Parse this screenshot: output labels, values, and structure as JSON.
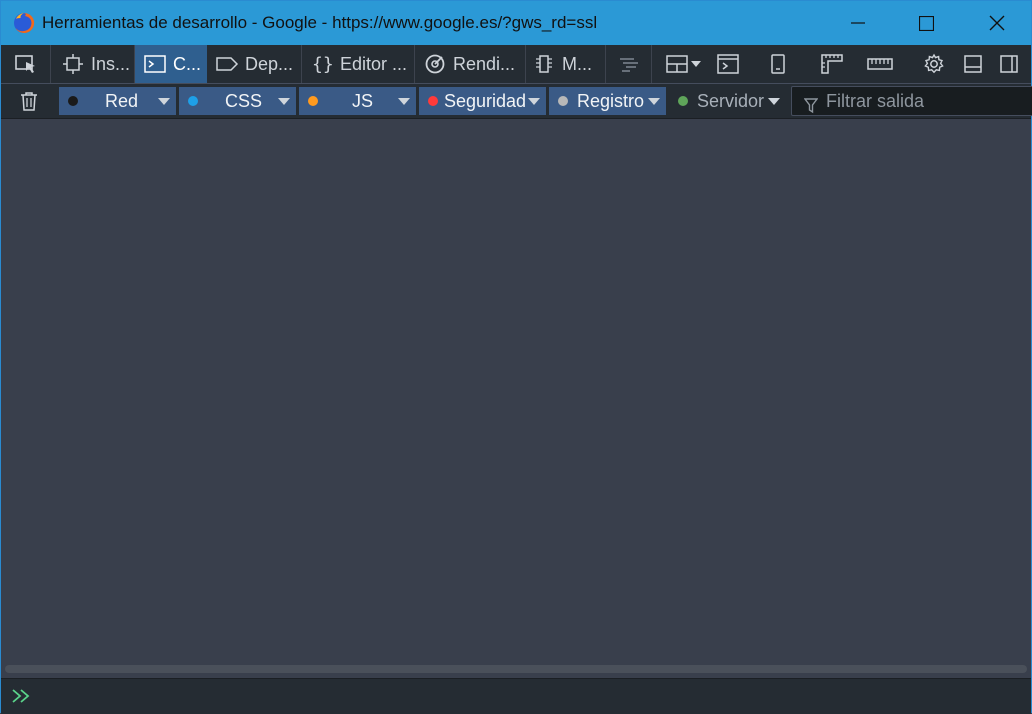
{
  "window": {
    "title": "Herramientas de desarrollo - Google - https://www.google.es/?gws_rd=ssl",
    "app_icon": "firefox-icon",
    "controls": [
      "minimize-icon",
      "maximize-icon",
      "close-icon"
    ]
  },
  "tabs": [
    {
      "label": "Ins...",
      "icon": "inspector-icon"
    },
    {
      "label": "C...",
      "icon": "console-icon",
      "selected": true
    },
    {
      "label": "Dep...",
      "icon": "debugger-icon"
    },
    {
      "label": "Editor ...",
      "icon": "style-editor-icon"
    },
    {
      "label": "Rendi...",
      "icon": "performance-icon"
    },
    {
      "label": "M...",
      "icon": "memory-icon"
    }
  ],
  "toolbar_icons": [
    "pick-element-icon",
    "waterfall-icon",
    "layout-dropdown-icon",
    "scratchpad-icon",
    "responsive-icon",
    "rulers-icon",
    "measure-icon",
    "settings-gear-icon",
    "dock-bottom-icon",
    "dock-side-icon"
  ],
  "filters": [
    {
      "label": "Red",
      "dot_color": "#1a1a1a"
    },
    {
      "label": "CSS",
      "dot_color": "#1ea0e8"
    },
    {
      "label": "JS",
      "dot_color": "#ff9a1e"
    },
    {
      "label": "Seguridad",
      "dot_color": "#ff3a3a"
    },
    {
      "label": "Registro",
      "dot_color": "#b8b8b8"
    },
    {
      "label": "Servidor",
      "dot_color": "#5fa55a"
    }
  ],
  "filter_input": {
    "placeholder": "Filtrar salida"
  },
  "colors": {
    "titlebar": "#2b99d6",
    "toolbar": "#252c33",
    "output_bg": "#393f4c",
    "selected_tab": "#2f5f8f",
    "prompt": "#5ad38a"
  }
}
